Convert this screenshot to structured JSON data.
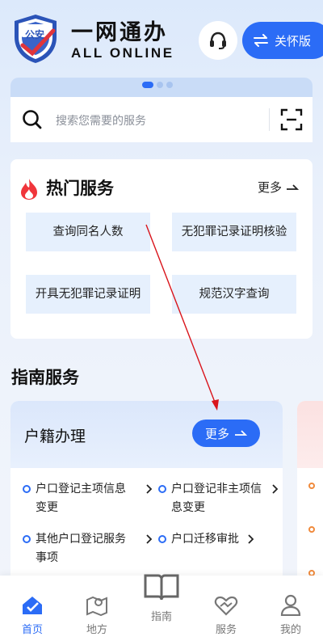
{
  "header": {
    "badge_text": "公安",
    "brand_cn": "一网通办",
    "brand_en": "ALL ONLINE",
    "care_label": "关怀版",
    "support_icon": "headset-icon",
    "care_icon": "swap-arrows-icon"
  },
  "search": {
    "placeholder": "搜索您需要的服务",
    "scan_icon": "scan-icon"
  },
  "hot": {
    "title": "热门服务",
    "more_label": "更多",
    "items": [
      {
        "label": "查询同名人数"
      },
      {
        "label": "无犯罪记录证明核验"
      },
      {
        "label": "开具无犯罪记录证明"
      },
      {
        "label": "规范汉字查询"
      }
    ]
  },
  "guide": {
    "title": "指南服务",
    "card": {
      "title": "户籍办理",
      "more_label": "更多",
      "items": [
        {
          "label": "户口登记主项信息变更"
        },
        {
          "label": "户口登记非主项信息变更"
        },
        {
          "label": "其他户口登记服务事项"
        },
        {
          "label": "户口迁移审批"
        }
      ]
    }
  },
  "nav": {
    "items": [
      {
        "label": "首页",
        "icon": "home-check-icon",
        "active": true
      },
      {
        "label": "地方",
        "icon": "map-pin-icon",
        "active": false
      },
      {
        "label": "指南",
        "icon": "book-icon",
        "active": false
      },
      {
        "label": "服务",
        "icon": "heart-hands-icon",
        "active": false
      },
      {
        "label": "我的",
        "icon": "user-icon",
        "active": false
      }
    ]
  },
  "colors": {
    "accent": "#2b6cf6",
    "annotation_arrow": "#d9141b",
    "tile_bg": "#e6f0fd"
  }
}
